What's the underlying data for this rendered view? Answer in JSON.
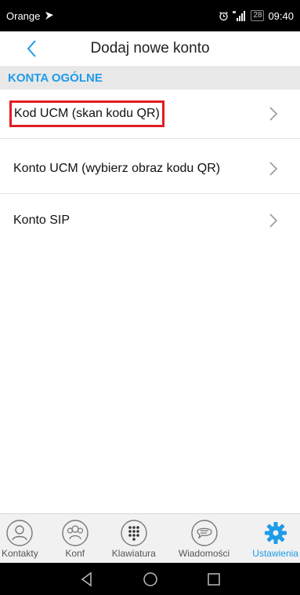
{
  "status_bar": {
    "carrier": "Orange",
    "battery": "28",
    "time": "09:40"
  },
  "header": {
    "title": "Dodaj nowe konto"
  },
  "section": {
    "title": "KONTA OGÓLNE"
  },
  "items": [
    {
      "label": "Kod UCM (skan kodu QR)",
      "highlighted": true
    },
    {
      "label": "Konto UCM (wybierz obraz kodu QR)"
    },
    {
      "label": "Konto SIP"
    }
  ],
  "tabs": [
    {
      "label": "Kontakty",
      "icon": "contacts-icon"
    },
    {
      "label": "Konf",
      "icon": "conference-icon"
    },
    {
      "label": "Klawiatura",
      "icon": "dialpad-icon"
    },
    {
      "label": "Wiadomości",
      "icon": "messages-icon"
    },
    {
      "label": "Ustawienia",
      "icon": "settings-icon",
      "active": true
    }
  ],
  "colors": {
    "accent": "#1f9be8",
    "highlight_border": "#e11d23",
    "section_bg": "#e8e8e8"
  }
}
